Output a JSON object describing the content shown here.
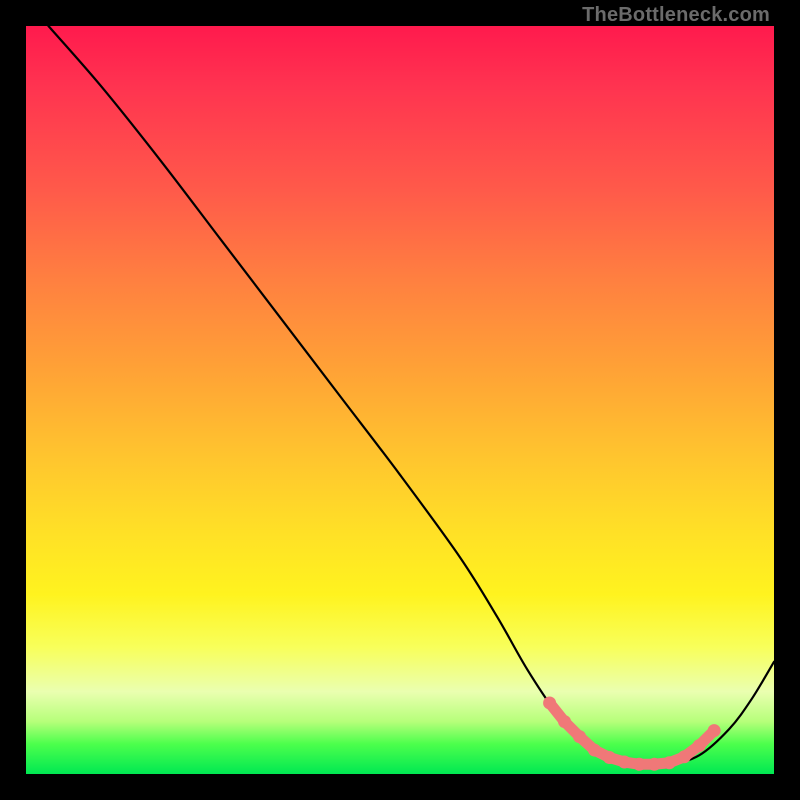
{
  "attribution": "TheBottleneck.com",
  "chart_data": {
    "type": "line",
    "title": "",
    "xlabel": "",
    "ylabel": "",
    "xlim": [
      0,
      100
    ],
    "ylim": [
      0,
      100
    ],
    "series": [
      {
        "name": "curve",
        "color": "#000000",
        "x": [
          3,
          10,
          18,
          26,
          34,
          42,
          50,
          58,
          63,
          67,
          71,
          74,
          78,
          82,
          86,
          90,
          94,
          97,
          100
        ],
        "y": [
          100,
          92,
          82,
          71.5,
          61,
          50.5,
          40,
          29,
          21,
          14,
          8,
          4.5,
          2.2,
          1.3,
          1.3,
          2.5,
          6,
          10,
          15
        ]
      }
    ],
    "highlight": {
      "name": "optimal-range",
      "color": "#f07878",
      "points": [
        {
          "x": 70,
          "y": 9.5
        },
        {
          "x": 72,
          "y": 7
        },
        {
          "x": 74,
          "y": 5
        },
        {
          "x": 76,
          "y": 3.2
        },
        {
          "x": 78,
          "y": 2.2
        },
        {
          "x": 80,
          "y": 1.6
        },
        {
          "x": 82,
          "y": 1.3
        },
        {
          "x": 84,
          "y": 1.3
        },
        {
          "x": 86,
          "y": 1.5
        },
        {
          "x": 88,
          "y": 2.3
        },
        {
          "x": 90,
          "y": 3.8
        },
        {
          "x": 92,
          "y": 5.8
        }
      ]
    }
  }
}
